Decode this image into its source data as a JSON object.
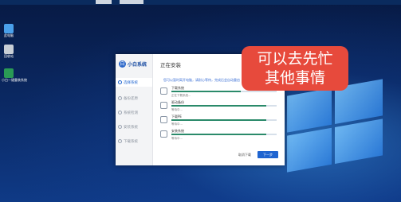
{
  "desktop": {
    "icons": [
      {
        "label": "此电脑",
        "icon": "computer-icon"
      },
      {
        "label": "回收站",
        "icon": "recycle-bin-icon"
      },
      {
        "label": "小白一键重装系统",
        "icon": "installer-app-icon"
      }
    ]
  },
  "app": {
    "brand": "小白系统",
    "title": "正在安装",
    "nav": [
      {
        "label": "选择系统",
        "active": true
      },
      {
        "label": "备份还原",
        "active": false
      },
      {
        "label": "系统检测",
        "active": false
      },
      {
        "label": "安装系统",
        "active": false
      },
      {
        "label": "下载系统",
        "active": false
      }
    ],
    "notice": "您可以暂时离开电脑，请耐心等待，完成后会自动重启",
    "tasks": [
      {
        "name": "下载系统",
        "status": "正在下载系统...",
        "progress": 0.66,
        "pct": "66%"
      },
      {
        "name": "驱动备份",
        "status": "等待中...",
        "progress": 0.9,
        "pct": ""
      },
      {
        "name": "下载PE",
        "status": "等待中...",
        "progress": 0.9,
        "pct": ""
      },
      {
        "name": "安装系统",
        "status": "等待中...",
        "progress": 0.9,
        "pct": ""
      }
    ],
    "buttons": {
      "cancel": "取消下载",
      "next": "下一步"
    }
  },
  "callout": {
    "line1": "可以去先忙",
    "line2": "其他事情"
  },
  "colors": {
    "accent": "#1f64d0",
    "callout": "#e74a3c",
    "progress": "#2a8a6a"
  }
}
